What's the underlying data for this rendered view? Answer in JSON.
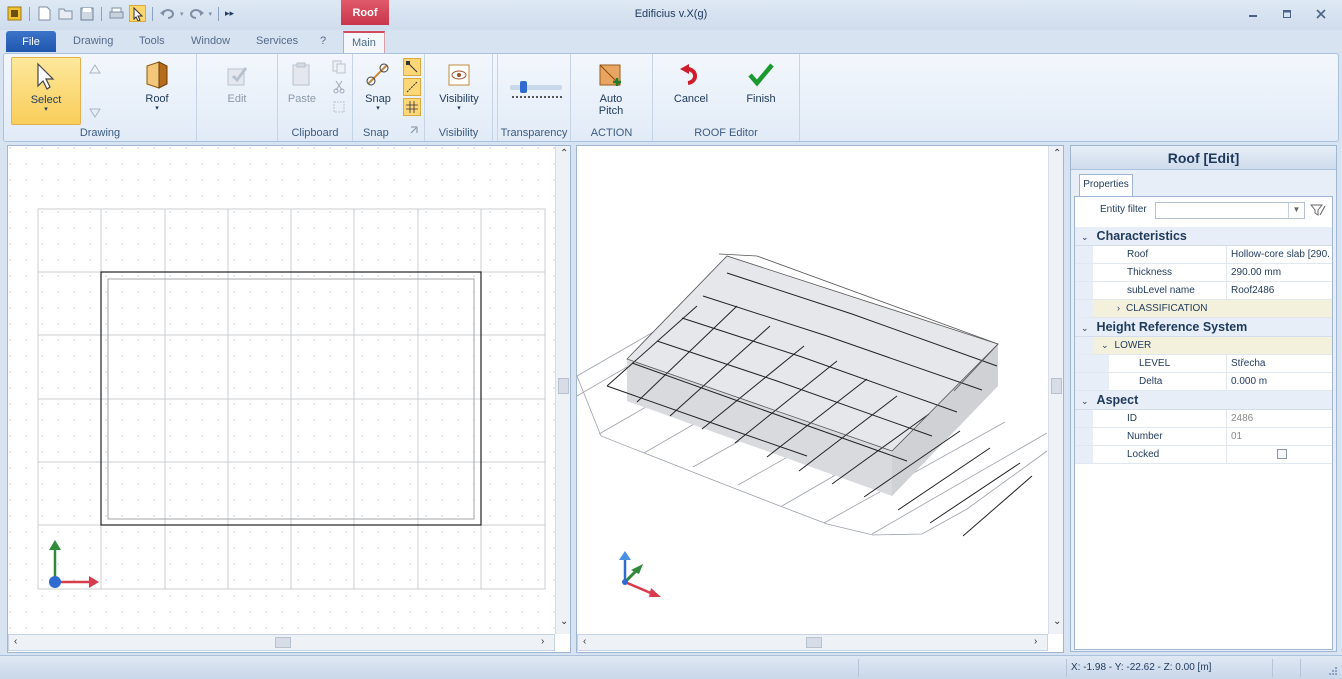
{
  "app": {
    "title": "Edificius v.X(g)",
    "context_tab": "Roof"
  },
  "tabs": {
    "file": "File",
    "drawing": "Drawing",
    "tools": "Tools",
    "window": "Window",
    "services": "Services",
    "help": "?",
    "main": "Main"
  },
  "ribbon": {
    "select": "Select",
    "roof": "Roof",
    "edit": "Edit",
    "paste": "Paste",
    "snap": "Snap",
    "visibility": "Visibility",
    "auto_pitch_1": "Auto",
    "auto_pitch_2": "Pitch",
    "cancel": "Cancel",
    "finish": "Finish",
    "groups": {
      "drawing": "Drawing",
      "clipboard": "Clipboard",
      "snap": "Snap",
      "visibility": "Visibility",
      "transparency": "Transparency",
      "action": "ACTION",
      "roof_editor": "ROOF Editor"
    }
  },
  "properties": {
    "title": "Roof [Edit]",
    "tab": "Properties",
    "entity_filter": "Entity filter",
    "characteristics": {
      "label": "Characteristics",
      "roof_k": "Roof",
      "roof_v": "Hollow-core slab [290.",
      "thickness_k": "Thickness",
      "thickness_v": "290.00 mm",
      "sublevel_k": "subLevel name",
      "sublevel_v": "Roof2486",
      "classification": "CLASSIFICATION"
    },
    "height": {
      "label": "Height Reference System",
      "lower": "LOWER",
      "level_k": "LEVEL",
      "level_v": "Střecha",
      "delta_k": "Delta",
      "delta_v": "0.000 m"
    },
    "aspect": {
      "label": "Aspect",
      "id_k": "ID",
      "id_v": "2486",
      "number_k": "Number",
      "number_v": "01",
      "locked_k": "Locked"
    }
  },
  "status": {
    "coords": "X: -1.98 - Y: -22.62 - Z: 0.00 [m]"
  },
  "colors": {
    "accent": "#d04a5e",
    "select_highlight": "#f9cd5b",
    "finish_check": "#1a9a2e",
    "cancel_arrow": "#d11d2b"
  }
}
